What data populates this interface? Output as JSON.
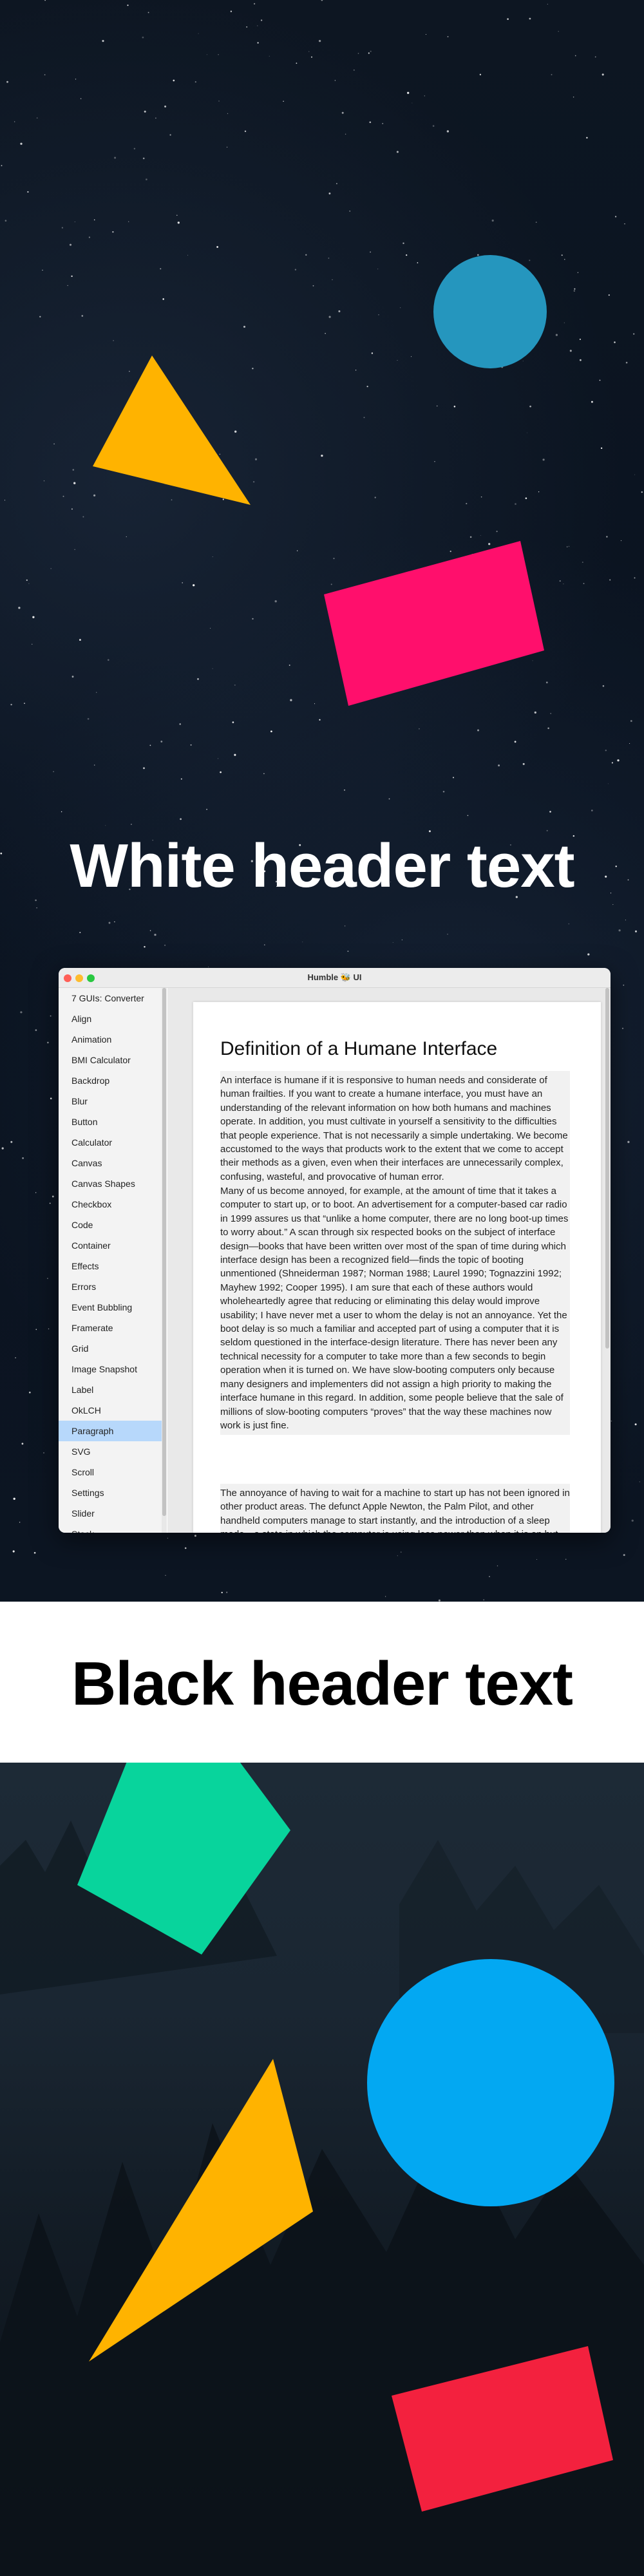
{
  "headers": {
    "white": "White header text",
    "black": "Black header text"
  },
  "colors": {
    "teal_circle": "#2596be",
    "amber_triangle": "#ffb300",
    "pink_rect": "#ff0f6c",
    "green_pentagon": "#08d49c",
    "blue_circle": "#03a8f2",
    "red_rect": "#f3213e"
  },
  "window": {
    "title": "Humble 🐝 UI",
    "sidebar": {
      "items": [
        "7 GUIs: Converter",
        "Align",
        "Animation",
        "BMI Calculator",
        "Backdrop",
        "Blur",
        "Button",
        "Calculator",
        "Canvas",
        "Canvas Shapes",
        "Checkbox",
        "Code",
        "Container",
        "Effects",
        "Errors",
        "Event Bubbling",
        "Framerate",
        "Grid",
        "Image Snapshot",
        "Label",
        "OkLCH",
        "Paragraph",
        "SVG",
        "Scroll",
        "Settings",
        "Slider",
        "Stack"
      ],
      "selected": "Paragraph"
    },
    "document": {
      "title": "Definition of a Humane Interface",
      "paragraphs": [
        "An interface is humane if it is responsive to human needs and considerate of human frailties. If you want to create a humane interface, you must have an understanding of the relevant information on how both humans and machines operate. In addition, you must cultivate in yourself a sensitivity to the difficulties that people experience. That is not necessarily a simple undertaking. We become accustomed to the ways that products work to the extent that we come to accept their methods as a given, even when their interfaces are unnecessarily complex, confusing, wasteful, and provocative of human error.",
        "Many of us become annoyed, for example, at the amount of time that it takes a computer to start up, or to boot. An advertisement for a computer-based car radio in 1999 assures us that “unlike a home computer, there are no long boot-up times to worry about.” A scan through six respected books on the subject of interface design—books that have been written over most of the span of time during which interface design has been a recognized field—finds the topic of booting unmentioned (Shneiderman 1987; Norman 1988; Laurel 1990; Tognazzini 1992; Mayhew 1992; Cooper 1995). I am sure that each of these authors would wholeheartedly agree that reducing or eliminating this delay would improve usability; I have never met a user to whom the delay is not an annoyance. Yet the boot delay is so much a familiar and accepted part of using a computer that it is seldom questioned in the interface-design literature. There has never been any technical necessity for a computer to take more than a few seconds to begin operation when it is turned on. We have slow-booting computers only because many designers and implementers did not assign a high priority to making the interface humane in this regard. In addition, some people believe that the sale of millions of slow-booting computers “proves” that the way these machines now work is just fine.",
        "The annoyance of having to wait for a machine to start up has not been ignored in other product areas. The defunct Apple Newton, the Palm Pilot, and other handheld computers manage to start instantly, and the introduction of a sleep mode—a state in which the computer is using less power than when it is on but from which it can be brought to operation almost instantly"
      ]
    }
  }
}
